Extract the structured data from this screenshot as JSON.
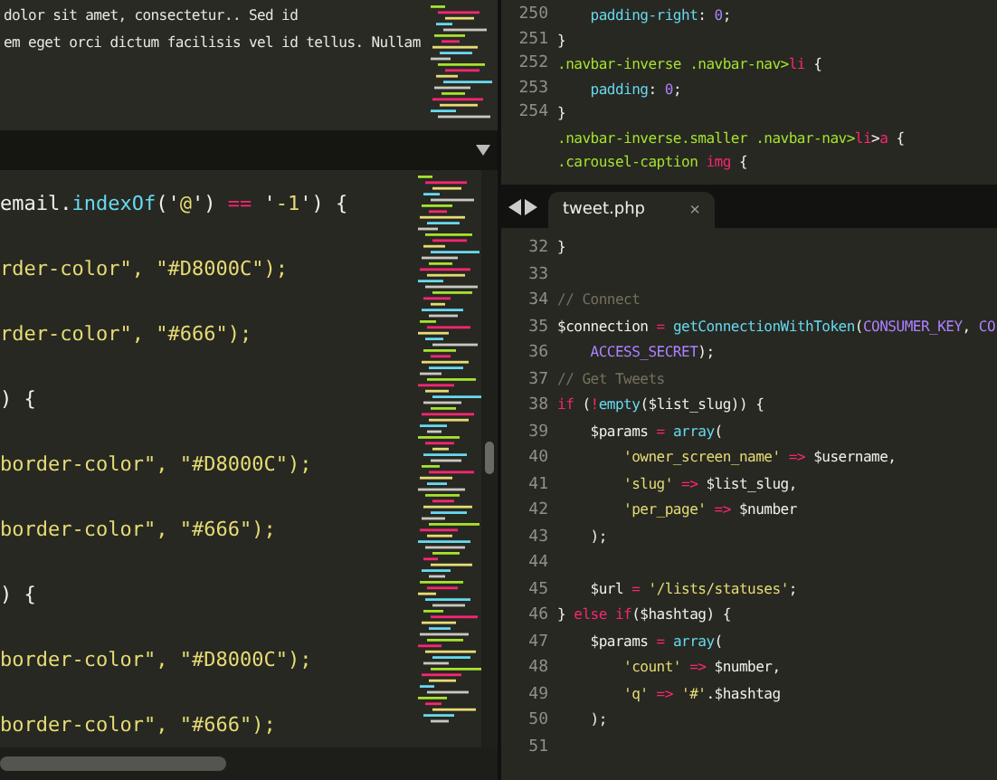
{
  "left_editor": {
    "text_lines": [
      "dolor sit amet, consectetur.. Sed id",
      "em eget orci dictum facilisis vel id tellus. Nullam"
    ],
    "code_lines": [
      {
        "kind": "code",
        "tokens": [
          {
            "text": "email.",
            "kind": "plain"
          },
          {
            "text": "indexOf",
            "kind": "fn"
          },
          {
            "text": "('",
            "kind": "plain"
          },
          {
            "text": "@",
            "kind": "str"
          },
          {
            "text": "') ",
            "kind": "plain"
          },
          {
            "text": "==",
            "kind": "kw"
          },
          {
            "text": " '",
            "kind": "plain"
          },
          {
            "text": "-1",
            "kind": "str"
          },
          {
            "text": "') {",
            "kind": "plain"
          }
        ]
      },
      {
        "kind": "blank"
      },
      {
        "kind": "code",
        "tokens": [
          {
            "text": "rder-color\", \"#D8000C\");",
            "kind": "str"
          }
        ]
      },
      {
        "kind": "blank"
      },
      {
        "kind": "code",
        "tokens": [
          {
            "text": "rder-color\", \"#666\");",
            "kind": "str"
          }
        ]
      },
      {
        "kind": "blank"
      },
      {
        "kind": "code",
        "tokens": [
          {
            "text": ") {",
            "kind": "plain"
          }
        ]
      },
      {
        "kind": "blank"
      },
      {
        "kind": "code",
        "tokens": [
          {
            "text": "border-color\", \"#D8000C\");",
            "kind": "str"
          }
        ]
      },
      {
        "kind": "blank"
      },
      {
        "kind": "code",
        "tokens": [
          {
            "text": "border-color\", \"#666\");",
            "kind": "str"
          }
        ]
      },
      {
        "kind": "blank"
      },
      {
        "kind": "code",
        "tokens": [
          {
            "text": ") {",
            "kind": "plain"
          }
        ]
      },
      {
        "kind": "blank"
      },
      {
        "kind": "code",
        "tokens": [
          {
            "text": "border-color\", \"#D8000C\");",
            "kind": "str"
          }
        ]
      },
      {
        "kind": "blank"
      },
      {
        "kind": "code",
        "tokens": [
          {
            "text": "border-color\", \"#666\");",
            "kind": "str"
          }
        ]
      }
    ]
  },
  "css_editor": {
    "lines": [
      {
        "number": "250",
        "tokens": [
          {
            "text": "    padding-right",
            "kind": "fn"
          },
          {
            "text": ": ",
            "kind": "plain"
          },
          {
            "text": "0",
            "kind": "const"
          },
          {
            "text": ";",
            "kind": "plain"
          }
        ]
      },
      {
        "number": "251",
        "tokens": [
          {
            "text": "}",
            "kind": "plain"
          }
        ]
      },
      {
        "number": "252",
        "tokens": [
          {
            "text": ".navbar-inverse .navbar-nav>",
            "kind": "sel"
          },
          {
            "text": "li",
            "kind": "kw"
          },
          {
            "text": " {",
            "kind": "plain"
          }
        ]
      },
      {
        "number": "253",
        "tokens": [
          {
            "text": "    padding",
            "kind": "fn"
          },
          {
            "text": ": ",
            "kind": "plain"
          },
          {
            "text": "0",
            "kind": "const"
          },
          {
            "text": ";",
            "kind": "plain"
          }
        ]
      },
      {
        "number": "254",
        "tokens": [
          {
            "text": "}",
            "kind": "plain"
          }
        ]
      },
      {
        "tokens": [
          {
            "text": ".navbar-inverse.smaller .navbar-nav>",
            "kind": "sel"
          },
          {
            "text": "li",
            "kind": "kw"
          },
          {
            "text": ">",
            "kind": "plain"
          },
          {
            "text": "a",
            "kind": "kw"
          },
          {
            "text": " {",
            "kind": "plain"
          }
        ]
      },
      {
        "tokens": [
          {
            "text": ".carousel-caption ",
            "kind": "sel"
          },
          {
            "text": "img",
            "kind": "kw"
          },
          {
            "text": " {",
            "kind": "plain"
          }
        ]
      }
    ]
  },
  "php_editor": {
    "tab": {
      "label": "tweet.php",
      "close": "×",
      "selected": true
    },
    "lines": [
      {
        "number": "32",
        "tokens": [
          {
            "text": "}",
            "kind": "plain"
          }
        ]
      },
      {
        "number": "33"
      },
      {
        "number": "34",
        "tokens": [
          {
            "text": "// Connect",
            "kind": "cmt"
          }
        ]
      },
      {
        "number": "35",
        "tokens": [
          {
            "text": "$connection ",
            "kind": "plain"
          },
          {
            "text": "=",
            "kind": "kw"
          },
          {
            "text": " getConnectionWithToken",
            "kind": "fn"
          },
          {
            "text": "(",
            "kind": "plain"
          },
          {
            "text": "CONSUMER_KEY",
            "kind": "const"
          },
          {
            "text": ", ",
            "kind": "plain"
          },
          {
            "text": "CO",
            "kind": "const"
          }
        ]
      },
      {
        "number": "36",
        "tokens": [
          {
            "text": "    ACCESS_SECRET",
            "kind": "const"
          },
          {
            "text": ");",
            "kind": "plain"
          }
        ]
      },
      {
        "number": "37",
        "tokens": [
          {
            "text": "// Get Tweets",
            "kind": "cmt"
          }
        ]
      },
      {
        "number": "38",
        "tokens": [
          {
            "text": "if",
            "kind": "kw"
          },
          {
            "text": " (",
            "kind": "plain"
          },
          {
            "text": "!",
            "kind": "kw"
          },
          {
            "text": "empty",
            "kind": "fn"
          },
          {
            "text": "($list_slug)) {",
            "kind": "plain"
          }
        ]
      },
      {
        "number": "39",
        "tokens": [
          {
            "text": "    $params ",
            "kind": "plain"
          },
          {
            "text": "=",
            "kind": "kw"
          },
          {
            "text": " array",
            "kind": "fn"
          },
          {
            "text": "(",
            "kind": "plain"
          }
        ]
      },
      {
        "number": "40",
        "tokens": [
          {
            "text": "        'owner_screen_name'",
            "kind": "str"
          },
          {
            "text": " => ",
            "kind": "kw"
          },
          {
            "text": "$username,",
            "kind": "plain"
          }
        ]
      },
      {
        "number": "41",
        "tokens": [
          {
            "text": "        'slug'",
            "kind": "str"
          },
          {
            "text": " => ",
            "kind": "kw"
          },
          {
            "text": "$list_slug,",
            "kind": "plain"
          }
        ]
      },
      {
        "number": "42",
        "tokens": [
          {
            "text": "        'per_page'",
            "kind": "str"
          },
          {
            "text": " => ",
            "kind": "kw"
          },
          {
            "text": "$number",
            "kind": "plain"
          }
        ]
      },
      {
        "number": "43",
        "tokens": [
          {
            "text": "    );",
            "kind": "plain"
          }
        ]
      },
      {
        "number": "44"
      },
      {
        "number": "45",
        "tokens": [
          {
            "text": "    $url ",
            "kind": "plain"
          },
          {
            "text": "=",
            "kind": "kw"
          },
          {
            "text": " '/lists/statuses'",
            "kind": "str"
          },
          {
            "text": ";",
            "kind": "plain"
          }
        ]
      },
      {
        "number": "46",
        "tokens": [
          {
            "text": "} ",
            "kind": "plain"
          },
          {
            "text": "else if",
            "kind": "kw"
          },
          {
            "text": "($hashtag) {",
            "kind": "plain"
          }
        ]
      },
      {
        "number": "47",
        "tokens": [
          {
            "text": "    $params ",
            "kind": "plain"
          },
          {
            "text": "=",
            "kind": "kw"
          },
          {
            "text": " array",
            "kind": "fn"
          },
          {
            "text": "(",
            "kind": "plain"
          }
        ]
      },
      {
        "number": "48",
        "tokens": [
          {
            "text": "        'count'",
            "kind": "str"
          },
          {
            "text": " => ",
            "kind": "kw"
          },
          {
            "text": "$number,",
            "kind": "plain"
          }
        ]
      },
      {
        "number": "49",
        "tokens": [
          {
            "text": "        'q'",
            "kind": "str"
          },
          {
            "text": " => ",
            "kind": "kw"
          },
          {
            "text": "'#'",
            "kind": "str"
          },
          {
            "text": ".$hashtag",
            "kind": "plain"
          }
        ]
      },
      {
        "number": "50",
        "tokens": [
          {
            "text": "    );",
            "kind": "plain"
          }
        ]
      },
      {
        "number": "51"
      }
    ]
  }
}
